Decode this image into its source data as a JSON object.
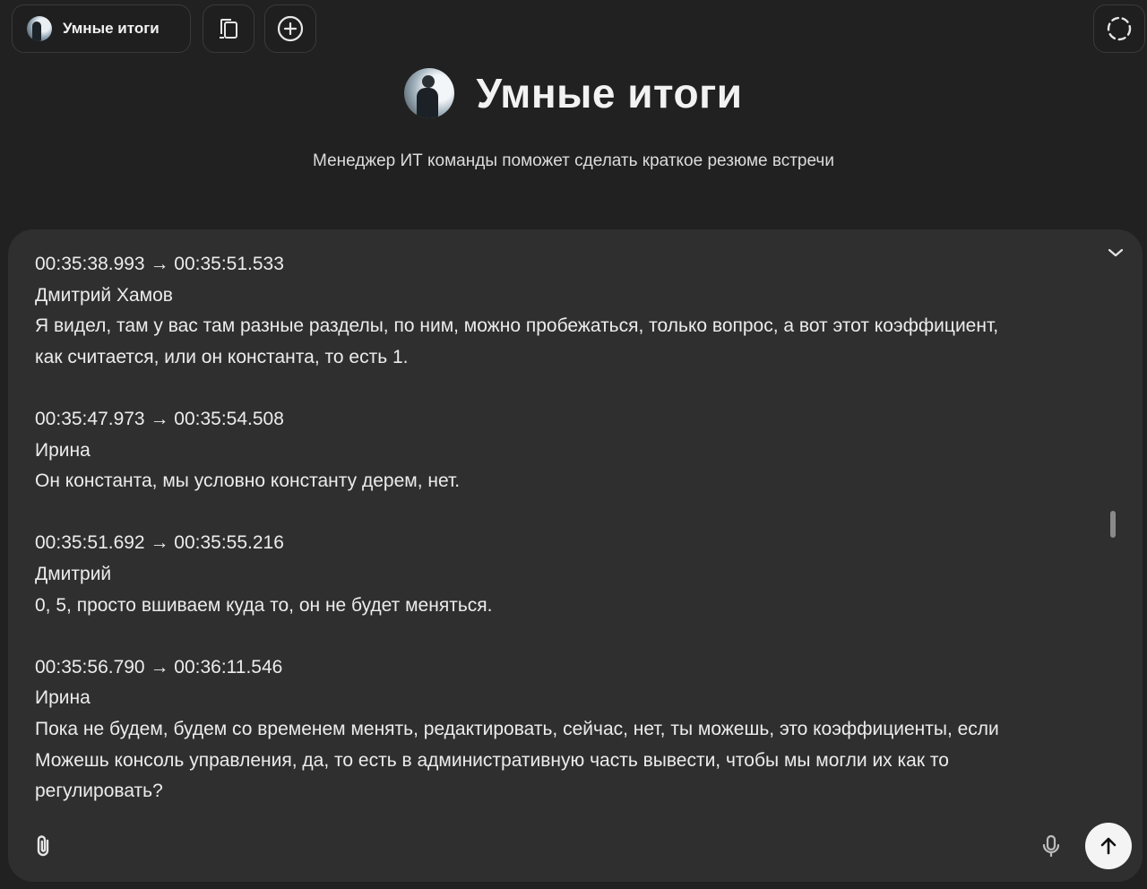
{
  "header": {
    "gpt_name": "Умные итоги",
    "icons": {
      "avatar": "avatar-icon",
      "library": "library-icon",
      "new_chat": "plus-circle-icon",
      "temporary_chat": "dashed-circle-icon"
    }
  },
  "hero": {
    "title": "Умные итоги",
    "subtitle": "Менеджер ИТ команды поможет сделать краткое резюме встречи"
  },
  "composer": {
    "entries": [
      {
        "time": "00:35:38.993 → 00:35:51.533",
        "speaker": "Дмитрий Хамов",
        "lines": [
          "Я видел, там у вас там разные разделы, по ним, можно пробежаться, только вопрос, а вот этот коэффициент,",
          "как считается, или он константа, то есть 1."
        ]
      },
      {
        "time": "00:35:47.973 → 00:35:54.508",
        "speaker": "Ирина",
        "lines": [
          "Он константа, мы условно константу дерем, нет."
        ]
      },
      {
        "time": "00:35:51.692 → 00:35:55.216",
        "speaker": "Дмитрий",
        "lines": [
          "0, 5, просто вшиваем куда то, он не будет меняться."
        ]
      },
      {
        "time": "00:35:56.790 → 00:36:11.546",
        "speaker": "Ирина",
        "lines": [
          "Пока не будем, будем со временем менять, редактировать, сейчас, нет, ты можешь, это коэффициенты, если",
          "Можешь консоль управления, да, то есть в административную часть вывести, чтобы мы могли их как то",
          "регулировать?"
        ]
      }
    ],
    "icons": {
      "collapse": "chevron-down-icon",
      "attach": "paperclip-icon",
      "mic": "microphone-icon",
      "send": "arrow-up-icon"
    }
  }
}
